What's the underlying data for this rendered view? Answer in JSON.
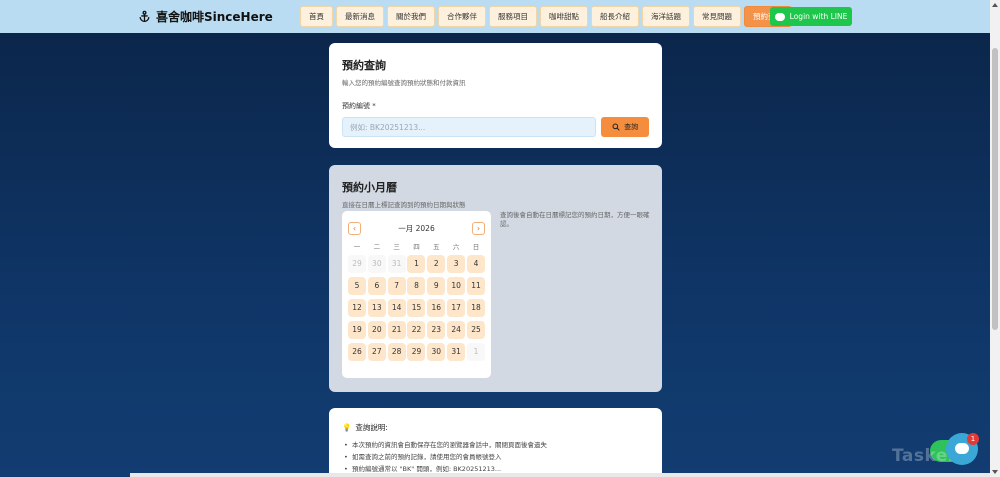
{
  "header": {
    "brand": "喜舍咖啡SinceHere",
    "nav": [
      "首頁",
      "最新消息",
      "關於我們",
      "合作夥伴",
      "服務項目",
      "咖啡甜點",
      "船長介紹",
      "海洋話題",
      "常見問題",
      "預約查詢"
    ],
    "active_nav": "預約查詢",
    "line_login": "Login with LINE"
  },
  "search": {
    "title": "預約查詢",
    "subtitle": "輸入您的預約編號查詢預約狀態和付款資訊",
    "label": "預約編號 *",
    "placeholder": "例如: BK20251213...",
    "button": "查詢"
  },
  "calendar": {
    "title": "預約小月曆",
    "subtitle": "直接在日曆上標記查詢到的預約日期與狀態",
    "month": "一月 2026",
    "weekdays": [
      "一",
      "二",
      "三",
      "四",
      "五",
      "六",
      "日"
    ],
    "weeks": [
      [
        "29",
        "30",
        "31",
        "1",
        "2",
        "3",
        "4"
      ],
      [
        "5",
        "6",
        "7",
        "8",
        "9",
        "10",
        "11"
      ],
      [
        "12",
        "13",
        "14",
        "15",
        "16",
        "17",
        "18"
      ],
      [
        "19",
        "20",
        "21",
        "22",
        "23",
        "24",
        "25"
      ],
      [
        "26",
        "27",
        "28",
        "29",
        "30",
        "31",
        "1"
      ]
    ],
    "note": "查詢後會自動在日曆標記您的預約日期，方便一眼確認。"
  },
  "info": {
    "title": "查詢說明:",
    "items": [
      "本次預約的資訊會自動保存在您的瀏覽器會話中，關閉頁面後會遺失",
      "如需查詢之前的預約記錄，請使用您的會員帳號登入",
      "預約編號通常以 \"BK\" 開頭，例如: BK20251213..."
    ]
  },
  "chat": {
    "badge": "1"
  },
  "watermark": "Tasker"
}
